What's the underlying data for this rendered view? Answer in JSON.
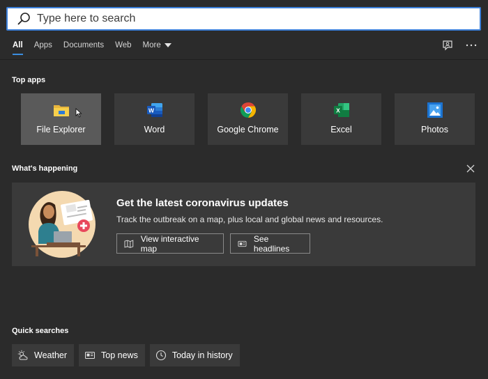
{
  "search": {
    "placeholder": "Type here to search"
  },
  "tabs": [
    {
      "label": "All",
      "active": true
    },
    {
      "label": "Apps"
    },
    {
      "label": "Documents"
    },
    {
      "label": "Web"
    },
    {
      "label": "More"
    }
  ],
  "top_apps": {
    "title": "Top apps",
    "items": [
      {
        "label": "File Explorer",
        "icon": "file-explorer-icon"
      },
      {
        "label": "Word",
        "icon": "word-icon"
      },
      {
        "label": "Google Chrome",
        "icon": "chrome-icon"
      },
      {
        "label": "Excel",
        "icon": "excel-icon"
      },
      {
        "label": "Photos",
        "icon": "photos-icon"
      }
    ]
  },
  "whats_happening": {
    "title": "What's happening",
    "card": {
      "title": "Get the latest coronavirus updates",
      "description": "Track the outbreak on a map, plus local and global news and resources.",
      "map_button": "View interactive map",
      "headlines_button": "See headlines"
    }
  },
  "quick_searches": {
    "title": "Quick searches",
    "items": [
      {
        "label": "Weather",
        "icon": "weather-icon"
      },
      {
        "label": "Top news",
        "icon": "news-icon"
      },
      {
        "label": "Today in history",
        "icon": "clock-icon"
      }
    ]
  },
  "colors": {
    "accent": "#3b8de0",
    "background": "#2b2b2b",
    "tile": "#3a3a3a",
    "tile_hover": "#5a5a5a"
  }
}
